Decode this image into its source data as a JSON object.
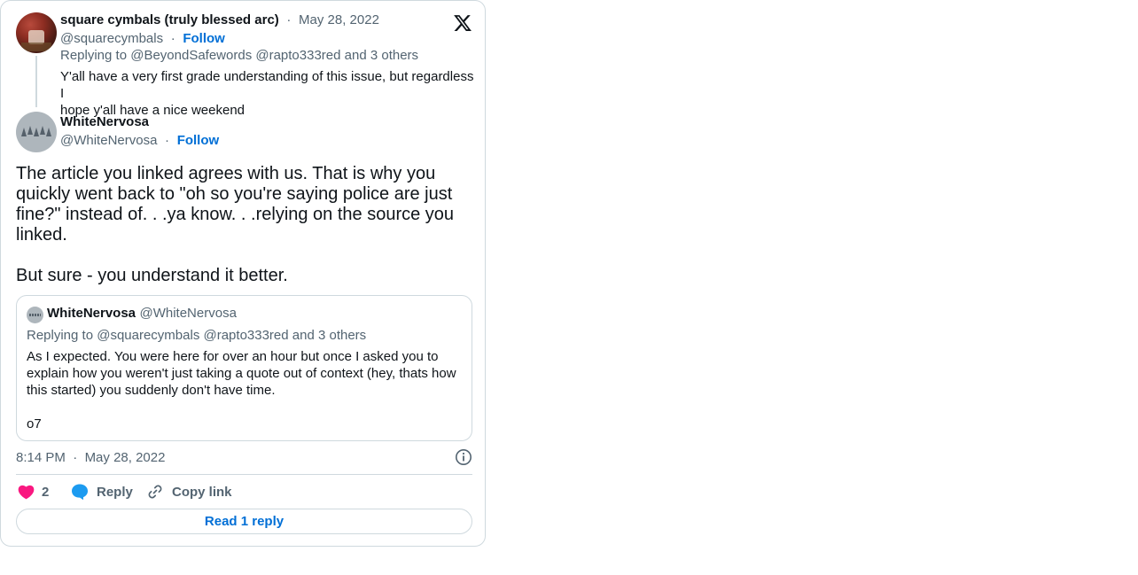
{
  "parent_tweet": {
    "author_name": "square cymbals (truly blessed arc)",
    "date": "May 28, 2022",
    "handle": "@squarecymbals",
    "follow_label": "Follow",
    "replying_prefix": "Replying to",
    "replying_to": "@BeyondSafewords @rapto333red and 3 others",
    "text_line1": "Y'all have a very first grade understanding of this issue, but regardless I",
    "text_line2": "hope y'all have a nice weekend"
  },
  "main_tweet": {
    "author_name": "WhiteNervosa",
    "handle": "@WhiteNervosa",
    "follow_label": "Follow",
    "text_line1": "The article you linked agrees with us. That is why you",
    "text_line2": "quickly went back to \"oh so you're saying police are just",
    "text_line3": "fine?\" instead of. . .ya know. . .relying on the source you",
    "text_line4": "linked.",
    "text_line5": "But sure - you understand it better.",
    "time": "8:14 PM",
    "date": "May 28, 2022"
  },
  "quoted_tweet": {
    "author_name": "WhiteNervosa",
    "handle": "@WhiteNervosa",
    "replying_prefix": "Replying to",
    "replying_to": "@squarecymbals @rapto333red and 3 others",
    "text_line1": "As I expected. You were here for over an hour but once I asked you to",
    "text_line2": "explain how you weren't just taking a quote out of context (hey, thats how",
    "text_line3": "this started) you suddenly don't have time.",
    "text_line4": "o7"
  },
  "actions": {
    "like_count": "2",
    "reply_label": "Reply",
    "copy_link_label": "Copy link",
    "read_replies_label": "Read 1 reply"
  },
  "colors": {
    "like": "#f91880",
    "reply": "#1d9bf0",
    "follow": "#006fd6",
    "border": "#cfd9de",
    "muted": "#536471"
  },
  "icons": [
    "x-logo-icon",
    "info-icon",
    "heart-icon",
    "reply-bubble-icon",
    "link-icon"
  ]
}
